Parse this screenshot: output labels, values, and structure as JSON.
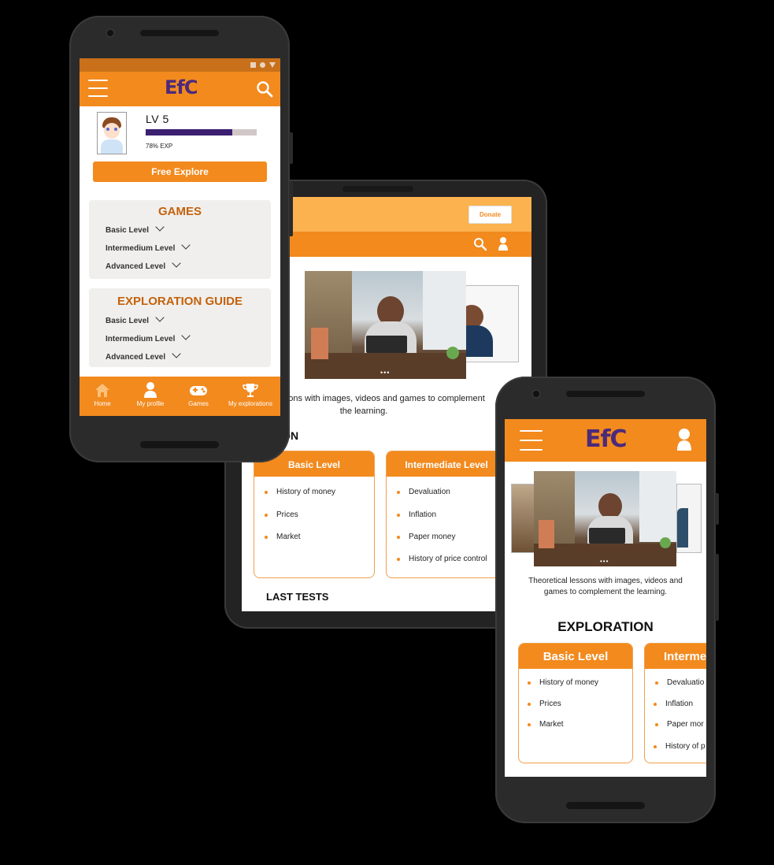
{
  "colors": {
    "accent": "#f28a1e",
    "brand_text": "#4b2a7b",
    "section_title": "#c4620c",
    "background": "#000000"
  },
  "phone1": {
    "app_logo": "EfC",
    "status_icons": [
      "square-icon",
      "circle-icon",
      "triangle-icon"
    ],
    "profile": {
      "level": "LV 5",
      "exp_text": "78% EXP",
      "exp_progress": 0.78
    },
    "free_explore_button": "Free Explore",
    "games": {
      "title": "GAMES",
      "levels": [
        "Basic Level",
        "Intermedium Level",
        "Advanced Level"
      ]
    },
    "exploration_guide": {
      "title": "EXPLORATION GUIDE",
      "levels": [
        "Basic Level",
        "Intermedium Level",
        "Advanced Level"
      ]
    },
    "bottom_nav": [
      {
        "label": "Home",
        "icon": "home-icon"
      },
      {
        "label": "My profile",
        "icon": "user-icon"
      },
      {
        "label": "Games",
        "icon": "gamepad-icon"
      },
      {
        "label": "My explorations",
        "icon": "trophy-icon"
      }
    ]
  },
  "tablet": {
    "donate_button": "Donate",
    "description": "oretical lessons with images, videos and games to complement the learning.",
    "exploration_title": "LORATION",
    "cards": [
      {
        "title": "Basic Level",
        "items": [
          "History of money",
          "Prices",
          "Market"
        ]
      },
      {
        "title": "Intermediate Level",
        "items": [
          "Devaluation",
          "Inflation",
          "Paper money",
          "History of price control"
        ]
      }
    ],
    "last_tests_title": "LAST TESTS"
  },
  "phone2": {
    "app_logo": "EfC",
    "description": "Theoretical lessons with images, videos and games to complement the learning.",
    "exploration_title": "EXPLORATION",
    "cards": [
      {
        "title": "Basic Level",
        "items": [
          "History of money",
          "Prices",
          "Market"
        ]
      },
      {
        "title": "Interme",
        "items": [
          "Devaluatio",
          "Inflation",
          "Paper mor",
          "History of p"
        ]
      }
    ]
  }
}
